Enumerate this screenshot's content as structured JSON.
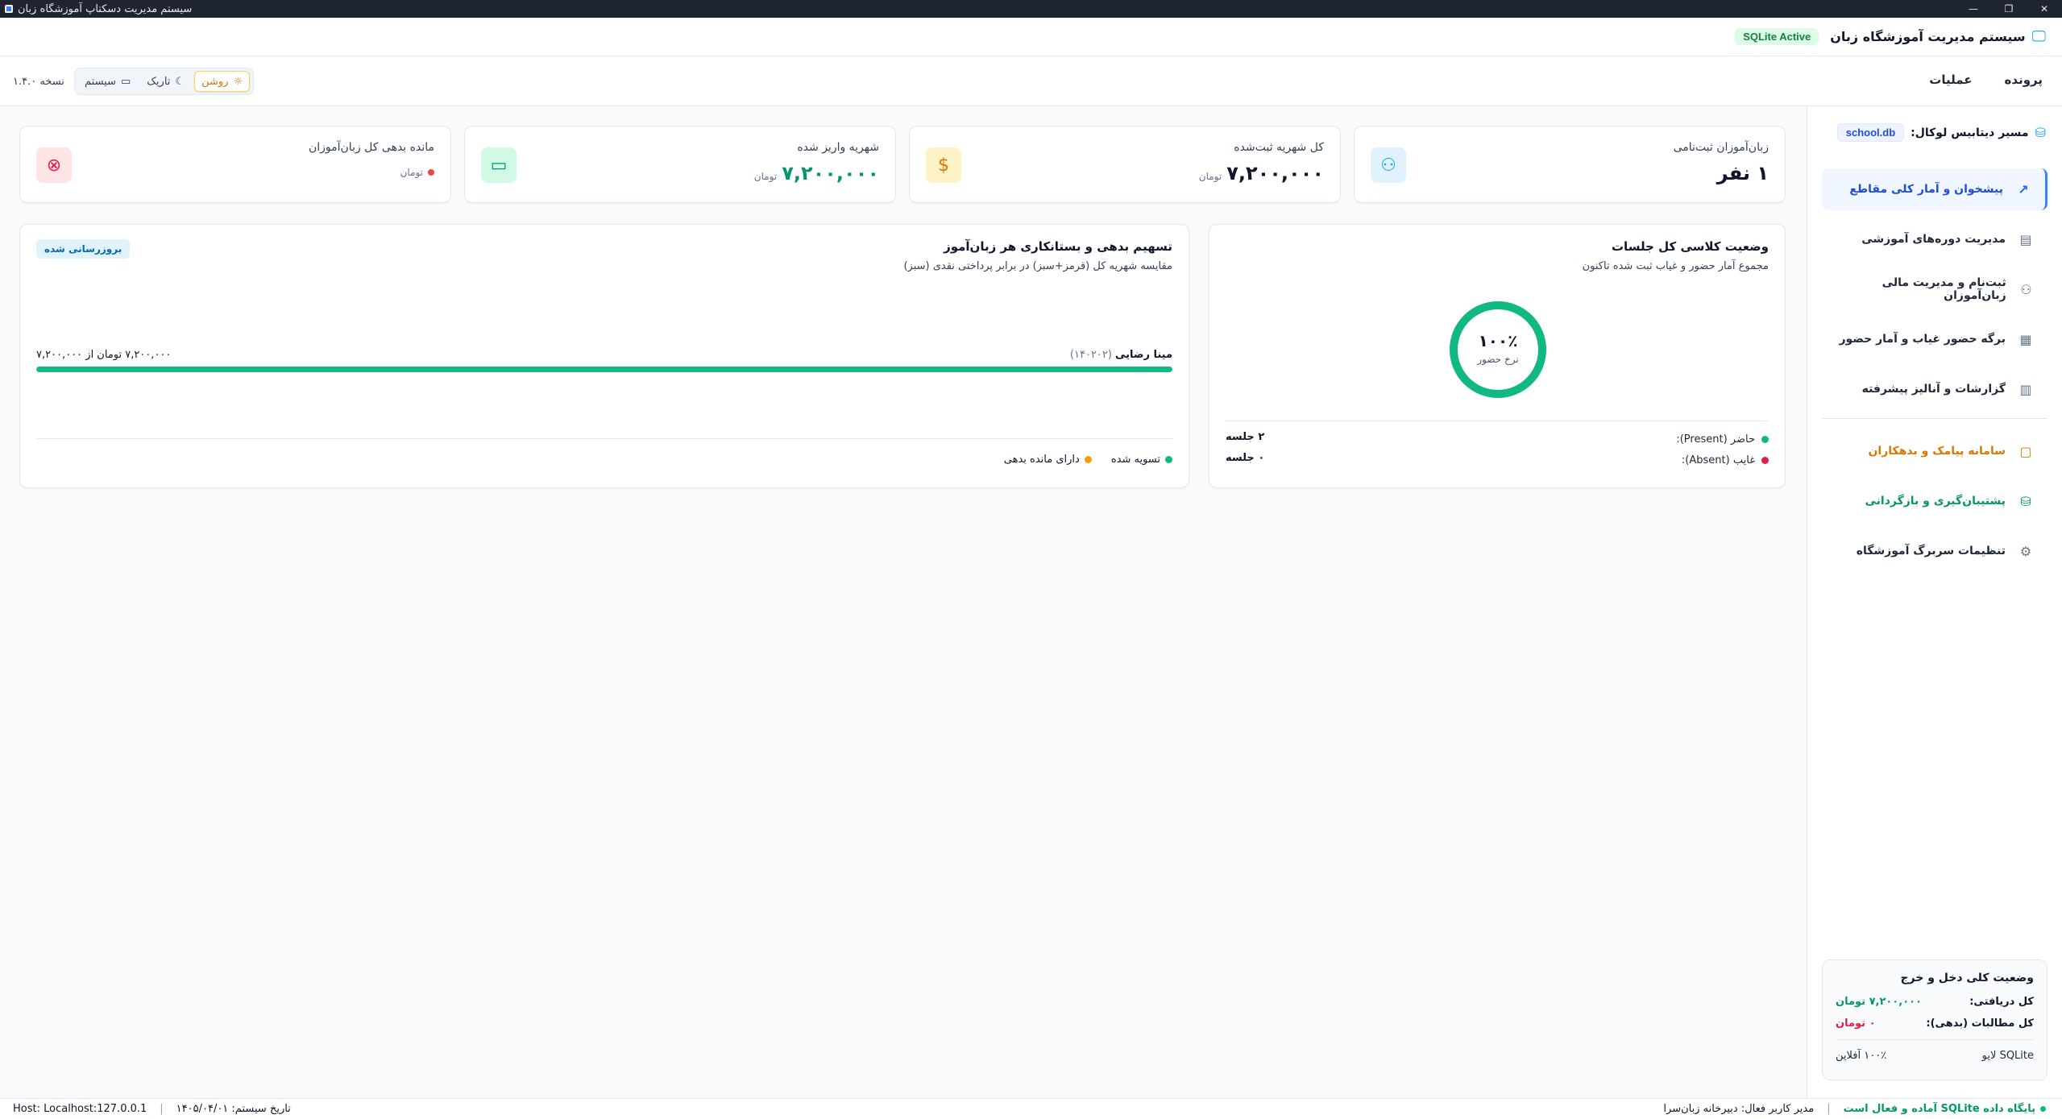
{
  "window": {
    "title": "سیستم مدیریت دسکتاپ آموزشگاه زبان"
  },
  "header": {
    "title": "سیستم مدیریت آموزشگاه زبان",
    "db_badge": "SQLite Active"
  },
  "menu": {
    "items": [
      "پرونده",
      "عملیات"
    ]
  },
  "theme": {
    "options": [
      {
        "label": "روشن",
        "icon": "sun-icon",
        "active": true
      },
      {
        "label": "تاریک",
        "icon": "moon-icon"
      },
      {
        "label": "سیستم",
        "icon": "monitor-icon"
      }
    ]
  },
  "version": "نسخه ۱.۴.۰",
  "sidebar": {
    "db_label": "مسیر دیتابیس لوکال:",
    "db_value": "school.db",
    "items": [
      {
        "label": "پیشخوان و آمار کلی مقاطع",
        "icon": "trend-icon",
        "active": true
      },
      {
        "label": "مدیریت دوره‌های آموزشی",
        "icon": "book-icon"
      },
      {
        "label": "ثبت‌نام و مدیریت مالی زبان‌آموزان",
        "icon": "users-icon"
      },
      {
        "label": "برگه حضور غیاب و آمار حضور",
        "icon": "calendar-icon"
      },
      {
        "label": "گزارشات و آنالیز پیشرفته",
        "icon": "bar-chart-icon"
      },
      {
        "label": "سامانه پیامک و بدهکاران",
        "icon": "message-icon",
        "accent": "#d97706"
      },
      {
        "label": "پشتیبان‌گیری و بازگردانی",
        "icon": "database-icon",
        "accent": "#059669"
      },
      {
        "label": "تنظیمات سربرگ آموزشگاه",
        "icon": "gear-icon"
      }
    ],
    "finance": {
      "title": "وضعیت کلی دخل و خرج",
      "received_label": "کل دریافتی:",
      "received_value": "۷,۲۰۰,۰۰۰ تومان",
      "debt_label": "کل مطالبات (بدهی):",
      "debt_value": "۰ تومان",
      "footer_right": "SQLite لایو",
      "footer_left": "۱۰۰٪ آفلاین"
    }
  },
  "kpis": [
    {
      "label": "زبان‌آموزان ثبت‌نامی",
      "value": "۱ نفر",
      "unit": "",
      "icon": "users-icon",
      "color": "#0ea5e9"
    },
    {
      "label": "کل شهریه ثبت‌شده",
      "value": "۷,۲۰۰,۰۰۰",
      "unit": "تومان",
      "icon": "dollar-icon",
      "color": "#d97706"
    },
    {
      "label": "شهریه واریز شده",
      "value": "۷,۲۰۰,۰۰۰",
      "unit": "تومان",
      "icon": "card-icon",
      "color": "#059669"
    },
    {
      "label": "مانده بدهی کل زبان‌آموزان",
      "value": "",
      "unit": "تومان",
      "icon": "x-circle-icon",
      "color": "#e11d48"
    }
  ],
  "attendance": {
    "title": "وضعیت کلاسی کل جلسات",
    "subtitle": "مجموع آمار حضور و غیاب ثبت شده تاکنون",
    "rate_value": "۱۰۰٪",
    "rate_fraction": 1.0,
    "rate_label": "نرخ حضور",
    "rows": [
      {
        "label": "حاضر (Present):",
        "value": "۲ جلسه",
        "color": "#10b981"
      },
      {
        "label": "غایب (Absent):",
        "value": "۰ جلسه",
        "color": "#e11d48"
      }
    ]
  },
  "debts": {
    "title": "تسهیم بدهی و بستانکاری هر زبان‌آموز",
    "subtitle": "مقایسه شهریه کل (قرمز+سبز) در برابر پرداختی نقدی (سبز)",
    "badge": "بروزرسانی شده",
    "students": [
      {
        "name": "مینا رضایی",
        "code": "(۱۴۰۲۰۲)",
        "amount_text": "۷,۲۰۰,۰۰۰ تومان از ۷,۲۰۰,۰۰۰",
        "paid_fraction": 1.0
      }
    ],
    "legend": [
      {
        "label": "تسویه شده",
        "color": "#10b981"
      },
      {
        "label": "دارای مانده بدهی",
        "color": "#f59e0b"
      }
    ]
  },
  "status": {
    "db_ready": "پایگاه داده SQLite آماده و فعال است",
    "user": "مدیر کاربر فعال: دبیرخانه زبان‌سرا",
    "date": "تاریخ سیستم: ۱۴۰۵/۰۴/۰۱",
    "host": "Host: Localhost:127.0.0.1"
  }
}
